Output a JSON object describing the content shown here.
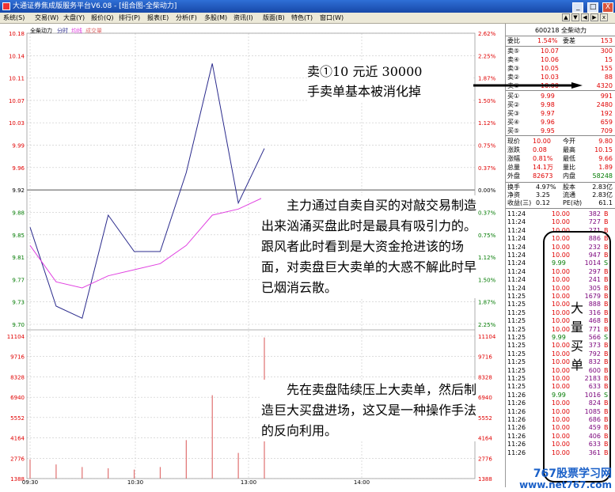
{
  "window": {
    "title": "大通证券焦成版服务平台V6.08 - [组合图-全柴动力]",
    "buttons": [
      "_",
      "□",
      "X"
    ]
  },
  "menu": [
    "系统(S)",
    "交易(W)",
    "大盘(Y)",
    "报价(Q)",
    "排行(P)",
    "报表(E)",
    "分析(F)",
    "多股(M)",
    "资讯(I)",
    "版面(B)",
    "特色(T)",
    "窗口(W)"
  ],
  "chart": {
    "legend": {
      "stock": "全柴动力",
      "timeshare": "分时",
      "avg": "均线",
      "volume": "成交量"
    },
    "price_ticks": [
      "10.18",
      "10.14",
      "10.11",
      "10.07",
      "10.03",
      "9.99",
      "9.96",
      "9.92",
      "9.88",
      "9.85",
      "9.81",
      "9.77",
      "9.73",
      "9.70"
    ],
    "pct_ticks": [
      "2.62%",
      "2.25%",
      "1.87%",
      "1.50%",
      "1.12%",
      "0.75%",
      "0.37%",
      "0.00%",
      "0.37%",
      "0.75%",
      "1.12%",
      "1.50%",
      "1.87%",
      "2.25%"
    ],
    "volume_ticks": [
      "11104",
      "9716",
      "8328",
      "6940",
      "5552",
      "4164",
      "2776",
      "1388"
    ],
    "time_ticks": [
      "09:30",
      "10:30",
      "13:00",
      "14:00"
    ],
    "colors": {
      "price": "#2a2a8c",
      "avg": "#e040e0",
      "volume": "#e07070",
      "up_text": "#e00000"
    }
  },
  "chart_data": {
    "type": "line",
    "x": [
      "09:30",
      "09:50",
      "10:10",
      "10:30",
      "11:00",
      "11:25",
      "13:00",
      "13:20",
      "13:35",
      "13:45"
    ],
    "series": [
      {
        "values": [
          9.86,
          9.73,
          9.71,
          9.88,
          9.82,
          9.82,
          9.95,
          10.13,
          9.9,
          9.99
        ]
      },
      {
        "values": [
          9.83,
          9.77,
          9.76,
          9.78,
          9.79,
          9.8,
          9.83,
          9.88,
          9.89,
          9.91
        ]
      }
    ],
    "volume": [
      1500,
      1100,
      900,
      800,
      700,
      900,
      3000,
      6500,
      2000,
      11000
    ],
    "ylim": [
      9.7,
      10.18
    ]
  },
  "quote": {
    "code_name": "600218 全柴动力",
    "weibi": {
      "label": "委比",
      "value": "1.54%",
      "label2": "委差",
      "value2": "153"
    },
    "sells": [
      {
        "label": "卖⑤",
        "price": "10.07",
        "vol": "300"
      },
      {
        "label": "卖④",
        "price": "10.06",
        "vol": "15"
      },
      {
        "label": "卖③",
        "price": "10.05",
        "vol": "155"
      },
      {
        "label": "卖②",
        "price": "10.03",
        "vol": "88"
      },
      {
        "label": "卖①",
        "price": "10.00",
        "vol": "4320"
      }
    ],
    "buys": [
      {
        "label": "买①",
        "price": "9.99",
        "vol": "991"
      },
      {
        "label": "买②",
        "price": "9.98",
        "vol": "2480"
      },
      {
        "label": "买③",
        "price": "9.97",
        "vol": "192"
      },
      {
        "label": "买④",
        "price": "9.96",
        "vol": "659"
      },
      {
        "label": "买⑤",
        "price": "9.95",
        "vol": "709"
      }
    ],
    "stats": [
      {
        "l1": "现价",
        "v1": "10.00",
        "l2": "今开",
        "v2": "9.80"
      },
      {
        "l1": "涨跌",
        "v1": "0.08",
        "l2": "最高",
        "v2": "10.15"
      },
      {
        "l1": "涨幅",
        "v1": "0.81%",
        "l2": "最低",
        "v2": "9.66"
      },
      {
        "l1": "总量",
        "v1": "14.1万",
        "l2": "量比",
        "v2": "1.89"
      },
      {
        "l1": "外盘",
        "v1": "82673",
        "l2": "内盘",
        "v2": "58248"
      }
    ],
    "stats2": [
      {
        "l1": "换手",
        "v1": "4.97%",
        "l2": "股本",
        "v2": "2.83亿"
      },
      {
        "l1": "净资",
        "v1": "3.25",
        "l2": "流通",
        "v2": "2.83亿"
      },
      {
        "l1": "收益(三)",
        "v1": "0.12",
        "l2": "PE(动)",
        "v2": "61.1"
      }
    ]
  },
  "trades": [
    {
      "t": "11:24",
      "p": "10.00",
      "v": "382",
      "f": "B"
    },
    {
      "t": "11:24",
      "p": "10.00",
      "v": "727",
      "f": "B"
    },
    {
      "t": "11:24",
      "p": "10.00",
      "v": "271",
      "f": "B"
    },
    {
      "t": "11:24",
      "p": "10.00",
      "v": "886",
      "f": "B"
    },
    {
      "t": "11:24",
      "p": "10.00",
      "v": "232",
      "f": "B"
    },
    {
      "t": "11:24",
      "p": "10.00",
      "v": "947",
      "f": "B"
    },
    {
      "t": "11:24",
      "p": "9.99",
      "v": "1014",
      "f": "S"
    },
    {
      "t": "11:24",
      "p": "10.00",
      "v": "297",
      "f": "B"
    },
    {
      "t": "11:24",
      "p": "10.00",
      "v": "241",
      "f": "B"
    },
    {
      "t": "11:24",
      "p": "10.00",
      "v": "305",
      "f": "B"
    },
    {
      "t": "11:25",
      "p": "10.00",
      "v": "1679",
      "f": "B"
    },
    {
      "t": "11:25",
      "p": "10.00",
      "v": "888",
      "f": "B"
    },
    {
      "t": "11:25",
      "p": "10.00",
      "v": "316",
      "f": "B"
    },
    {
      "t": "11:25",
      "p": "10.00",
      "v": "468",
      "f": "B"
    },
    {
      "t": "11:25",
      "p": "10.00",
      "v": "771",
      "f": "B"
    },
    {
      "t": "11:25",
      "p": "9.99",
      "v": "566",
      "f": "S"
    },
    {
      "t": "11:25",
      "p": "10.00",
      "v": "373",
      "f": "B"
    },
    {
      "t": "11:25",
      "p": "10.00",
      "v": "792",
      "f": "B"
    },
    {
      "t": "11:25",
      "p": "10.00",
      "v": "832",
      "f": "B"
    },
    {
      "t": "11:25",
      "p": "10.00",
      "v": "600",
      "f": "B"
    },
    {
      "t": "11:25",
      "p": "10.00",
      "v": "2183",
      "f": "B"
    },
    {
      "t": "11:25",
      "p": "10.00",
      "v": "633",
      "f": "B"
    },
    {
      "t": "11:26",
      "p": "9.99",
      "v": "1016",
      "f": "S"
    },
    {
      "t": "11:26",
      "p": "10.00",
      "v": "824",
      "f": "B"
    },
    {
      "t": "11:26",
      "p": "10.00",
      "v": "1085",
      "f": "B"
    },
    {
      "t": "11:26",
      "p": "10.00",
      "v": "686",
      "f": "B"
    },
    {
      "t": "11:26",
      "p": "10.00",
      "v": "459",
      "f": "B"
    },
    {
      "t": "11:26",
      "p": "10.00",
      "v": "406",
      "f": "B"
    },
    {
      "t": "11:26",
      "p": "10.00",
      "v": "633",
      "f": "B"
    },
    {
      "t": "11:26",
      "p": "10.00",
      "v": "361",
      "f": "B"
    }
  ],
  "annotations": {
    "note1_line1": "卖①10  元近  30000",
    "note1_line2": "手卖单基本被消化掉",
    "note2": "主力通过自卖自买的对敲交易制造出来汹涌买盘此时是最具有吸引力的。跟风者此时看到是大资金抢进该的场面，对卖盘巨大卖单的大惑不解此时早已烟消云散。",
    "note3": "先在卖盘陆续压上大卖单，然后制造巨大买盘进场，这又是一种操作手法的反向利用。",
    "vertical": [
      "大",
      "量",
      "买",
      "单"
    ]
  },
  "watermark": {
    "line1": "767股票学习网",
    "line2": "www.net767.com"
  }
}
